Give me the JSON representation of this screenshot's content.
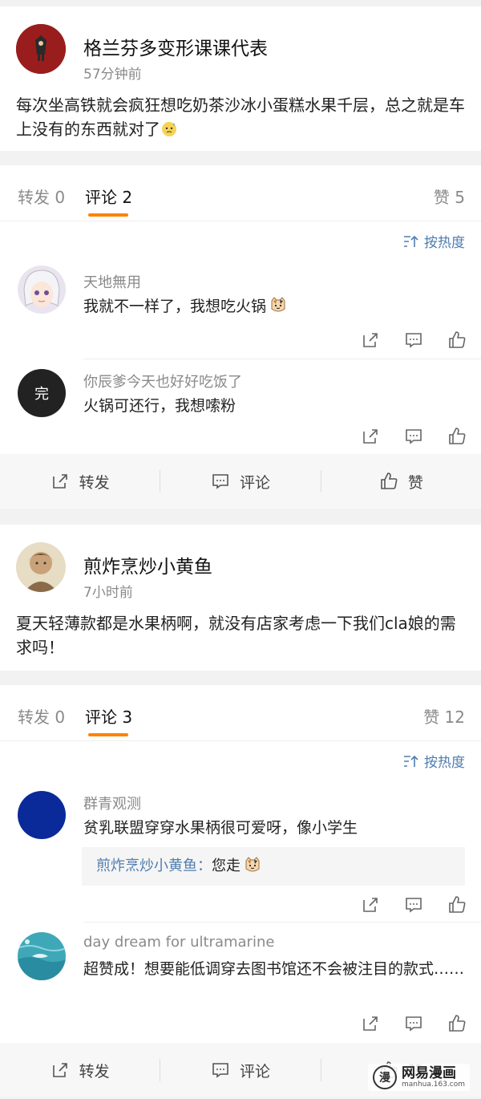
{
  "posts": [
    {
      "author": "格兰芬多变形课课代表",
      "time": "57分钟前",
      "text": "每次坐高铁就会疯狂想吃奶茶沙冰小蛋糕水果千层，总之就是车上没有的东西就对了",
      "tabs": {
        "repost": "转发 0",
        "comment": "评论 2",
        "like": "赞 5"
      },
      "sort_label": "按热度",
      "comments": [
        {
          "name": "天地無用",
          "text": "我就不一样了，我想吃火锅"
        },
        {
          "name": "你辰爹今天也好好吃饭了",
          "avatar_text": "完",
          "text": "火锅可还行，我想嗦粉"
        }
      ],
      "footer": {
        "repost": "转发",
        "comment": "评论",
        "like": "赞"
      }
    },
    {
      "author": "煎炸烹炒小黄鱼",
      "time": "7小时前",
      "text": "夏天轻薄款都是水果柄啊，就没有店家考虑一下我们cla娘的需求吗！",
      "tabs": {
        "repost": "转发 0",
        "comment": "评论 3",
        "like": "赞 12"
      },
      "sort_label": "按热度",
      "comments": [
        {
          "name": "群青观测",
          "text": "贫乳联盟穿穿水果柄很可爱呀，像小学生",
          "reply_name": "煎炸烹炒小黄鱼：",
          "reply_text": "您走"
        },
        {
          "name": "day dream for ultramarine",
          "text": "超赞成！想要能低调穿去图书馆还不会被注目的款式……"
        }
      ],
      "footer": {
        "repost": "转发",
        "comment": "评论",
        "like": "赞"
      }
    }
  ],
  "watermark": {
    "logo": "漫",
    "name": "网易漫画",
    "url": "manhua.163.com"
  },
  "colors": {
    "accent": "#ff8200",
    "link": "#507daf"
  }
}
